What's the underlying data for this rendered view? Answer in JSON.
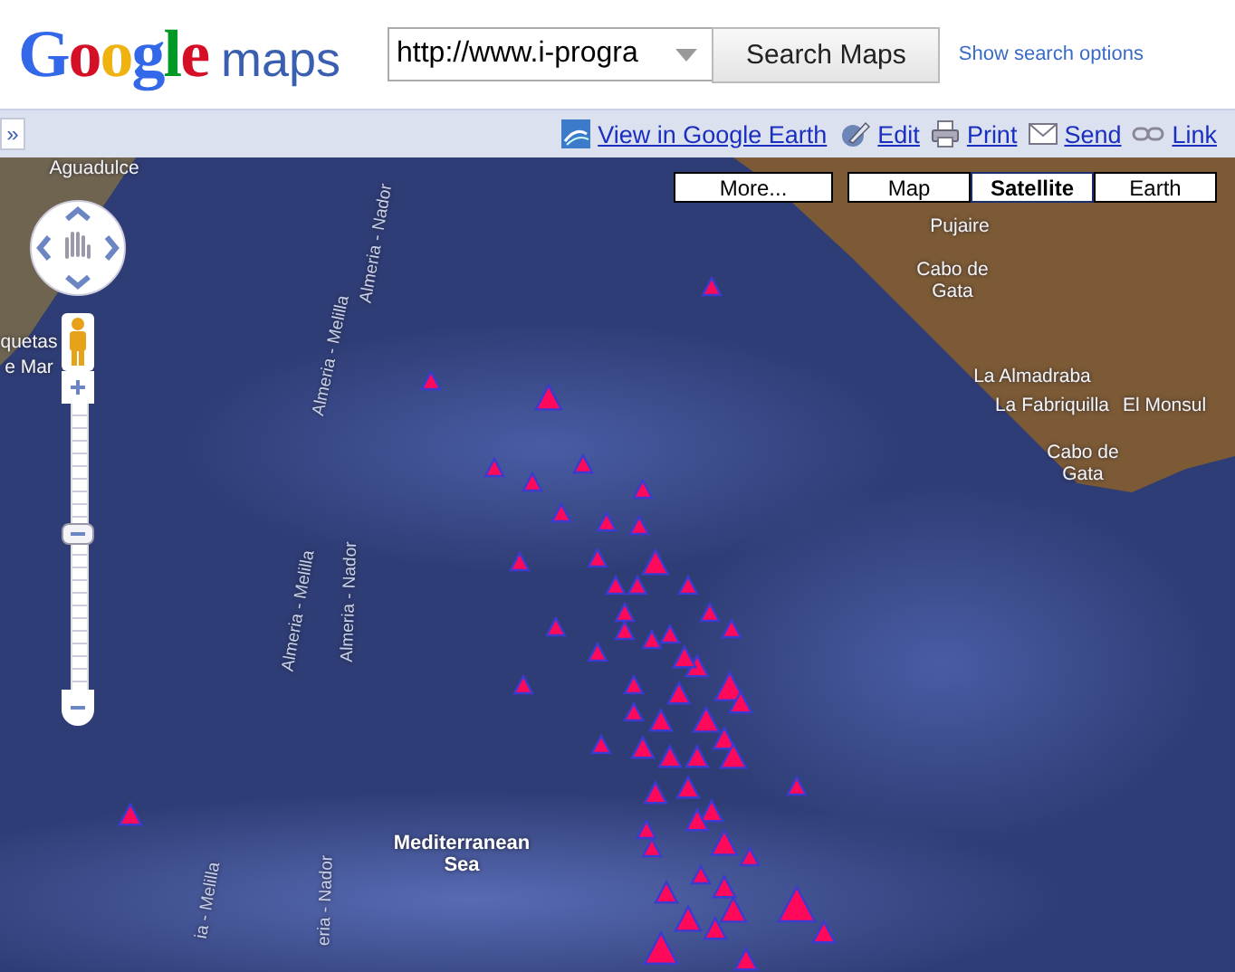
{
  "header": {
    "logo": {
      "brand": "Google",
      "product": "maps"
    },
    "search": {
      "value": "http://www.i-progra"
    },
    "search_button": "Search Maps",
    "options_link": "Show search options"
  },
  "toolbar": {
    "collapse": "»",
    "links": [
      {
        "kind": "earth",
        "label": "View in Google Earth"
      },
      {
        "kind": "edit",
        "label": "Edit"
      },
      {
        "kind": "print",
        "label": "Print"
      },
      {
        "kind": "send",
        "label": "Send"
      },
      {
        "kind": "link",
        "label": "Link"
      }
    ]
  },
  "map": {
    "more_button": "More...",
    "map_types": [
      {
        "label": "Map",
        "selected": false
      },
      {
        "label": "Satellite",
        "selected": true
      },
      {
        "label": "Earth",
        "selected": false
      }
    ],
    "zoom": {
      "level": 0.53
    },
    "labels": [
      {
        "kind": "place",
        "text": "Aguadulce"
      },
      {
        "kind": "place",
        "text": "quetas"
      },
      {
        "kind": "place",
        "text": "e Mar"
      },
      {
        "kind": "route",
        "text": "Almeria - Nador"
      },
      {
        "kind": "route",
        "text": "Almeria - Melilla"
      },
      {
        "kind": "route",
        "text": "Almeria - Melilla"
      },
      {
        "kind": "route",
        "text": "Almeria - Nador"
      },
      {
        "kind": "route",
        "text": "ia - Melilla"
      },
      {
        "kind": "route",
        "text": "eria - Nador"
      },
      {
        "kind": "place",
        "text": "Pujaire"
      },
      {
        "kind": "place",
        "text": "Cabo de Gata"
      },
      {
        "kind": "place",
        "text": "La Almadraba"
      },
      {
        "kind": "place",
        "text": "La Fabriquilla"
      },
      {
        "kind": "place",
        "text": "El Monsul"
      },
      {
        "kind": "place",
        "text": "Cabo de Gata"
      },
      {
        "kind": "sea",
        "text": "Mediterranean Sea"
      }
    ]
  }
}
